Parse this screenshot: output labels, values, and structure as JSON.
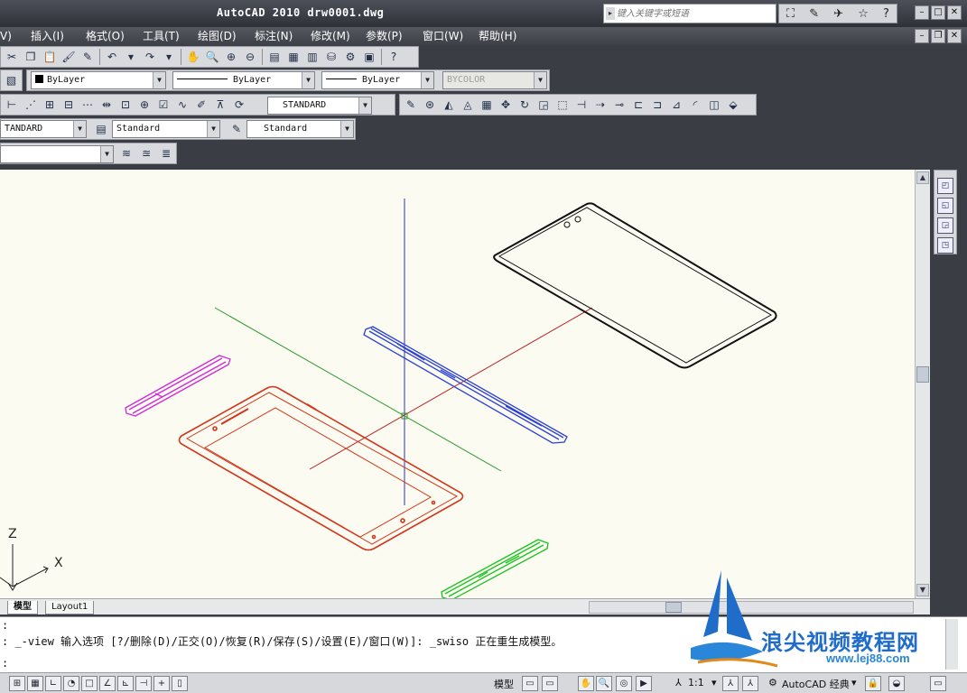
{
  "app": {
    "title": "AutoCAD 2010  drw0001.dwg",
    "search_placeholder": "键入关键字或短语"
  },
  "menu": [
    {
      "label": "V)",
      "key": "view"
    },
    {
      "label": "插入(I)",
      "key": "insert"
    },
    {
      "label": "格式(O)",
      "key": "format"
    },
    {
      "label": "工具(T)",
      "key": "tools"
    },
    {
      "label": "绘图(D)",
      "key": "draw"
    },
    {
      "label": "标注(N)",
      "key": "dimension"
    },
    {
      "label": "修改(M)",
      "key": "modify"
    },
    {
      "label": "参数(P)",
      "key": "parametric"
    },
    {
      "label": "窗口(W)",
      "key": "window"
    },
    {
      "label": "帮助(H)",
      "key": "help"
    }
  ],
  "properties": {
    "color": "ByLayer",
    "linetype": "ByLayer",
    "lineweight": "ByLayer",
    "plotstyle": "BYCOLOR"
  },
  "dimstyle": {
    "value": "STANDARD"
  },
  "styles": {
    "text_style": "TANDARD",
    "table_style": "Standard",
    "multileader_style": "Standard"
  },
  "layout_tabs": {
    "model": "模型",
    "layout1": "Layout1"
  },
  "command": {
    "line1": ":",
    "line2": ": _-view 输入选项 [?/删除(D)/正交(O)/恢复(R)/保存(S)/设置(E)/窗口(W)]: _swiso 正在重生成模型。",
    "line3": ":"
  },
  "status": {
    "model_label": "模型",
    "scale": "1:1",
    "workspace": "AutoCAD 经典"
  },
  "ucs": {
    "x_label": "X",
    "z_label": "Z"
  },
  "watermark": {
    "text": "浪尖视频教程网",
    "url": "www.lej88.com"
  },
  "colors": {
    "canvas": "#fbfbf2",
    "chrome_dark": "#3a3d44",
    "front_shell": "#d1351a",
    "side_strip_magenta": "#d12ad6",
    "side_strip_green": "#16c21b",
    "mid_strip_blue": "#2a3fd4",
    "back_panel": "#111111"
  }
}
